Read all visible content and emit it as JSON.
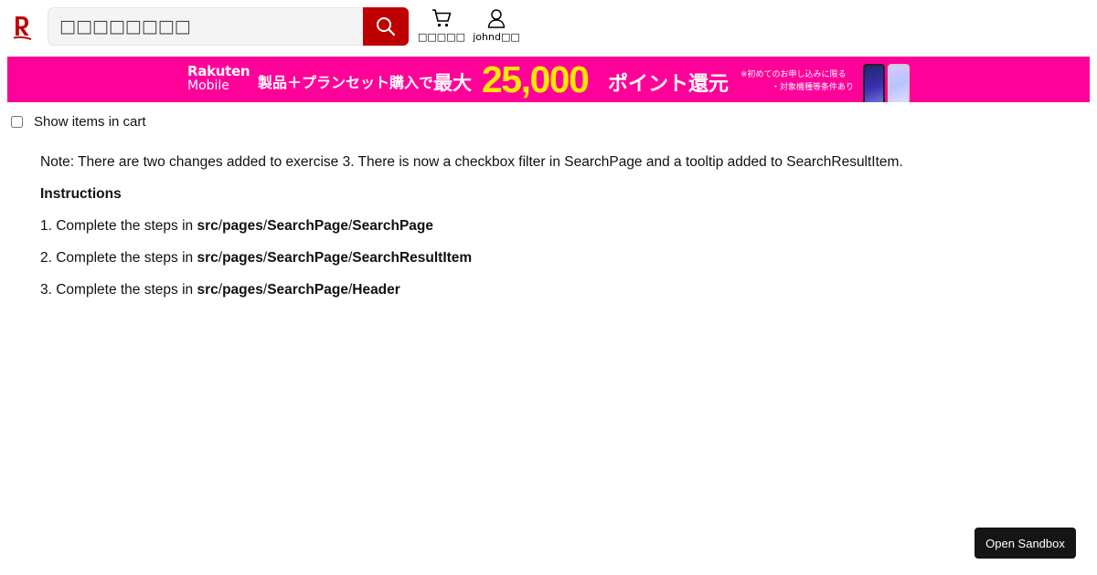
{
  "header": {
    "logo_text": "R",
    "search": {
      "placeholder": "□□□□□□□□",
      "value": ""
    },
    "cart_label": "□□□□□",
    "user_label": "johnd□□"
  },
  "banner": {
    "brand_top": "Rakuten",
    "brand_bottom": "Mobile",
    "offer": "製品＋プランセット購入で",
    "max": "最大",
    "amount": "25,000",
    "unit": "ポイント還元",
    "note_line1": "※初めてのお申し込みに限る",
    "note_line2": "・対象機種等条件あり"
  },
  "filter": {
    "label": "Show items in cart",
    "checked": false
  },
  "content": {
    "note": "Note: There are two changes added to exercise 3. There is now a checkbox filter in SearchPage and a tooltip added to SearchResultItem.",
    "heading": "Instructions",
    "steps": [
      {
        "prefix": "1. Complete the steps in ",
        "dir1": "src",
        "dir2": "pages",
        "dir3": "SearchPage",
        "file": "SearchPage"
      },
      {
        "prefix": "2. Complete the steps in ",
        "dir1": "src",
        "dir2": "pages",
        "dir3": "SearchPage",
        "file": "SearchResultItem"
      },
      {
        "prefix": "3. Complete the steps in ",
        "dir1": "src",
        "dir2": "pages",
        "dir3": "SearchPage",
        "file": "Header"
      }
    ],
    "separator": "/"
  },
  "sandbox_button": "Open Sandbox",
  "colors": {
    "brand_red": "#bf0000",
    "banner_pink": "#ff0099",
    "banner_yellow": "#ffe600"
  },
  "icons": [
    "rakuten-logo-icon",
    "search-icon",
    "cart-icon",
    "user-icon"
  ]
}
